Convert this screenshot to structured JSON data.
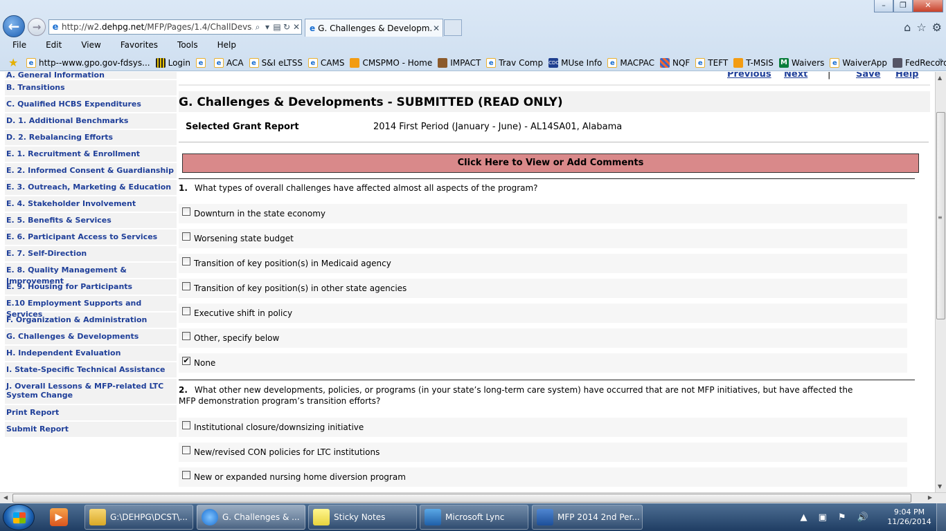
{
  "browser": {
    "address_host": "http://w2.",
    "address_domain": "dehpg.net",
    "address_path": "/MFP/Pages/1.4/ChallDevs...",
    "tab_title": "G. Challenges & Developm...",
    "menu": [
      "File",
      "Edit",
      "View",
      "Favorites",
      "Tools",
      "Help"
    ],
    "favorites": [
      {
        "label": "http--www.gpo.gov-fdsys...",
        "icon": "ie"
      },
      {
        "label": "Login",
        "icon": "bar"
      },
      {
        "label": "",
        "icon": "ie"
      },
      {
        "label": "ACA",
        "icon": "ie"
      },
      {
        "label": "S&I eLTSS",
        "icon": "ie"
      },
      {
        "label": "CAMS",
        "icon": "ie"
      },
      {
        "label": "CMSPMO - Home",
        "icon": "orange"
      },
      {
        "label": "IMPACT",
        "icon": "seal"
      },
      {
        "label": "Trav Comp",
        "icon": "ie"
      },
      {
        "label": "MUse Info",
        "icon": "cdc"
      },
      {
        "label": "MACPAC",
        "icon": "ie"
      },
      {
        "label": "NQF",
        "icon": "grid"
      },
      {
        "label": "TEFT",
        "icon": "ie"
      },
      {
        "label": "T-MSIS",
        "icon": "orange"
      },
      {
        "label": "Waivers",
        "icon": "m"
      },
      {
        "label": "WaiverApp",
        "icon": "ie"
      },
      {
        "label": "FedRecords",
        "icon": "fed"
      }
    ]
  },
  "sidebar": {
    "items": [
      "A. General Information",
      "B. Transitions",
      "C. Qualified HCBS Expenditures",
      "D. 1. Additional Benchmarks",
      "D. 2. Rebalancing Efforts",
      "E. 1. Recruitment & Enrollment",
      "E. 2. Informed Consent & Guardianship",
      "E. 3. Outreach, Marketing & Education",
      "E. 4. Stakeholder Involvement",
      "E. 5. Benefits & Services",
      "E. 6. Participant Access to Services",
      "E. 7. Self-Direction",
      "E. 8. Quality Management & Improvement",
      "E. 9. Housing for Participants",
      "E.10 Employment Supports and Services",
      "F. Organization & Administration",
      "G. Challenges & Developments",
      "H. Independent Evaluation",
      "I. State-Specific Technical Assistance",
      "J. Overall Lessons & MFP-related LTC System Change",
      "Print Report",
      "Submit Report"
    ]
  },
  "topnav": {
    "previous": "Previous",
    "next": "Next",
    "separator": "|",
    "save": "Save",
    "help": "Help"
  },
  "page": {
    "title": "G. Challenges & Developments - SUBMITTED (READ ONLY)",
    "grant_label": "Selected Grant Report",
    "grant_value": "2014 First Period (January - June) - AL14SA01, Alabama",
    "comments_button": "Click Here to View or Add Comments"
  },
  "questions": [
    {
      "number": "1.",
      "text": "What types of overall challenges have affected almost all aspects of the program?",
      "options": [
        {
          "label": "Downturn in the state economy",
          "checked": false
        },
        {
          "label": "Worsening state budget",
          "checked": false
        },
        {
          "label": "Transition of key position(s) in Medicaid agency",
          "checked": false
        },
        {
          "label": "Transition of key position(s) in other state agencies",
          "checked": false
        },
        {
          "label": "Executive shift in policy",
          "checked": false
        },
        {
          "label": "Other, specify below",
          "checked": false
        },
        {
          "label": "None",
          "checked": true
        }
      ]
    },
    {
      "number": "2.",
      "text": "What other new developments, policies, or programs (in your state’s long-term care system) have occurred that are not MFP initiatives, but have affected the MFP demonstration program’s transition efforts?",
      "options": [
        {
          "label": "Institutional closure/downsizing initiative",
          "checked": false
        },
        {
          "label": "New/revised CON policies for LTC institutions",
          "checked": false
        },
        {
          "label": "New or expanded nursing home diversion program",
          "checked": false
        }
      ]
    }
  ],
  "taskbar": {
    "tasks": [
      {
        "label": "G:\\DEHPG\\DCST\\...",
        "icon": "folder-icon"
      },
      {
        "label": "G. Challenges & ...",
        "icon": "ie-icon",
        "active": true
      },
      {
        "label": "Sticky Notes",
        "icon": "sticky-notes-icon"
      },
      {
        "label": "Microsoft Lync",
        "icon": "lync-icon"
      },
      {
        "label": "MFP 2014 2nd Per...",
        "icon": "word-icon"
      }
    ],
    "time": "9:04 PM",
    "date": "11/26/2014"
  },
  "colors": {
    "link": "#1f3f99",
    "comments_bg": "#d9898a",
    "nav_bg": "#f2f2f2"
  }
}
